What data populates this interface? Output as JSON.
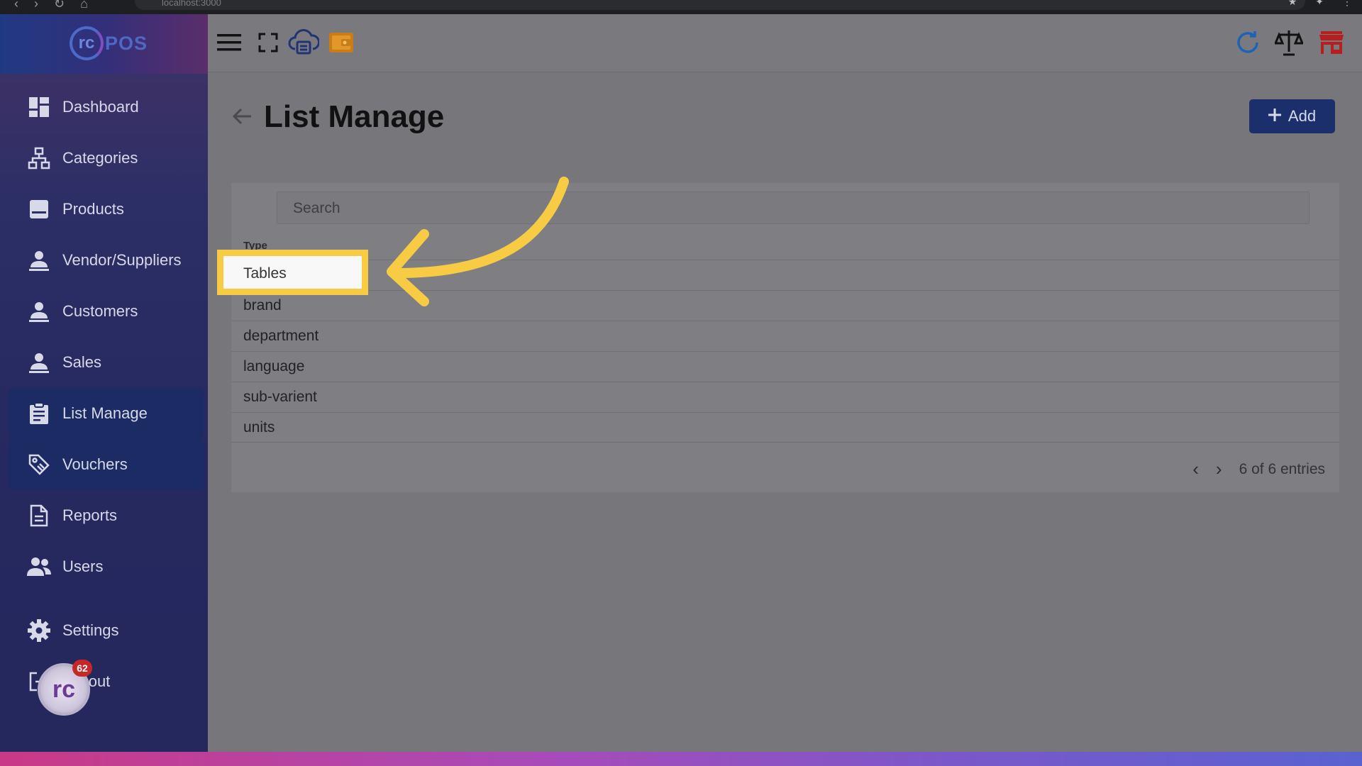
{
  "browser": {
    "url": "localhost:3000"
  },
  "brand": {
    "logo_mark": "rc",
    "logo_text": "POS"
  },
  "sidebar": {
    "items": [
      {
        "label": "Dashboard",
        "icon": "dashboard-icon"
      },
      {
        "label": "Categories",
        "icon": "hierarchy-icon"
      },
      {
        "label": "Products",
        "icon": "box-icon"
      },
      {
        "label": "Vendor/Suppliers",
        "icon": "person-icon"
      },
      {
        "label": "Customers",
        "icon": "person-icon"
      },
      {
        "label": "Sales",
        "icon": "person-icon"
      },
      {
        "label": "List Manage",
        "icon": "clipboard-icon"
      },
      {
        "label": "Vouchers",
        "icon": "tag-icon"
      },
      {
        "label": "Reports",
        "icon": "document-icon"
      },
      {
        "label": "Users",
        "icon": "users-icon"
      },
      {
        "label": "Settings",
        "icon": "gear-icon"
      },
      {
        "label": "Logout",
        "icon": "logout-icon"
      }
    ],
    "fab_badge": "62",
    "fab_mark": "rc"
  },
  "header": {
    "left_icons": [
      "menu-icon",
      "fullscreen-icon",
      "cloud-printer-icon",
      "wallet-icon"
    ],
    "right_icons": [
      "refresh-icon",
      "scale-icon",
      "store-icon"
    ]
  },
  "page": {
    "title": "List Manage",
    "back_icon": "arrow-left-icon",
    "add_button_label": "Add"
  },
  "table": {
    "search_placeholder": "Search",
    "column_header": "Type",
    "rows": [
      "Tables",
      "brand",
      "department",
      "language",
      "sub-varient",
      "units"
    ],
    "pagination_text": "6 of 6 entries"
  },
  "colors": {
    "highlight": "#f7cc44",
    "primary_button": "#1a2f6b",
    "active_menu": "#1c2b63"
  }
}
